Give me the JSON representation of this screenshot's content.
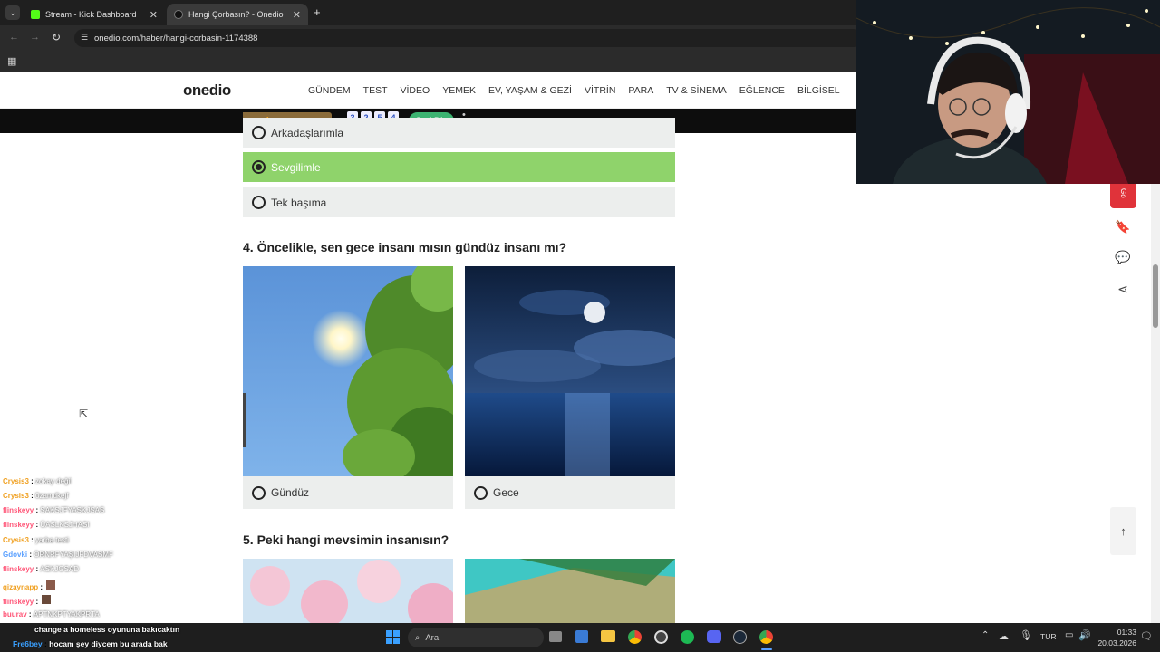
{
  "browser": {
    "tabs": [
      {
        "title": "Stream - Kick Dashboard"
      },
      {
        "title": "Hangi Çorbasın? - Onedio"
      }
    ],
    "url": "onedio.com/haber/hangi-corbasin-1174388"
  },
  "site": {
    "logo": "onedio",
    "nav": [
      "GÜNDEM",
      "TEST",
      "VİDEO",
      "YEMEK",
      "EV, YAŞAM & GEZİ",
      "VİTRİN",
      "PARA",
      "TV & SİNEMA",
      "EĞLENCE",
      "BİLGİSEL"
    ],
    "ad": {
      "brand_part1": "zone",
      "brand_part2": "okey",
      "tiles": [
        "3",
        "2",
        "5",
        "4"
      ],
      "cta": "Seri Diz"
    }
  },
  "quiz": {
    "q3_options": [
      {
        "label": "Arkadaşlarımla",
        "selected": false
      },
      {
        "label": "Sevgilimle",
        "selected": true
      },
      {
        "label": "Tek başıma",
        "selected": false
      }
    ],
    "q4": {
      "title": "4. Öncelikle, sen gece insanı mısın gündüz insanı mı?",
      "options": [
        "Gündüz",
        "Gece"
      ]
    },
    "q5": {
      "title": "5. Peki hangi mevsimin insanısın?"
    }
  },
  "side_tab_label": "Gö",
  "chat": [
    {
      "user": "Crysis3",
      "msg": "zokay değil",
      "color": "#f0a020"
    },
    {
      "user": "Crysis3",
      "msg": "0zamdkejf",
      "color": "#f0a020"
    },
    {
      "user": "flinskeyy",
      "msg": "SAKSJFYASKJSAS",
      "color": "#ff5577"
    },
    {
      "user": "flinskeyy",
      "msg": "ÜASLKSJHASI",
      "color": "#ff5577"
    },
    {
      "user": "Crysis3",
      "msg": "yarba testi",
      "color": "#f0a020"
    },
    {
      "user": "Gdovki",
      "msg": "ÖRNRFYAŞIJFDVASMF",
      "color": "#5aa0ff"
    },
    {
      "user": "flinskeyy",
      "msg": "ASKJGSAD",
      "color": "#ff5577"
    },
    {
      "user": "qizaynapp",
      "msg": "",
      "color": "#f0a020"
    },
    {
      "user": "flinskeyy",
      "msg": "",
      "color": "#ff5577"
    },
    {
      "user": "buurav",
      "msg": "APTNKPTYAKPRTA",
      "color": "#ff5577"
    },
    {
      "user": "",
      "msg": "change a homeless oyununa bakıcaktın",
      "color": "#ff5577"
    },
    {
      "user": "Fre6bey",
      "msg": "hocam şey diycem bu arada bak",
      "color": "#3aa0ff"
    }
  ],
  "taskbar": {
    "search": "Ara",
    "lang": "TUR",
    "time": "01:33",
    "date": "20.03.2026"
  },
  "colors": {
    "selected_option": "#8fd36b",
    "seri_diz": "#3cb371",
    "side_tab": "#e0333a"
  }
}
